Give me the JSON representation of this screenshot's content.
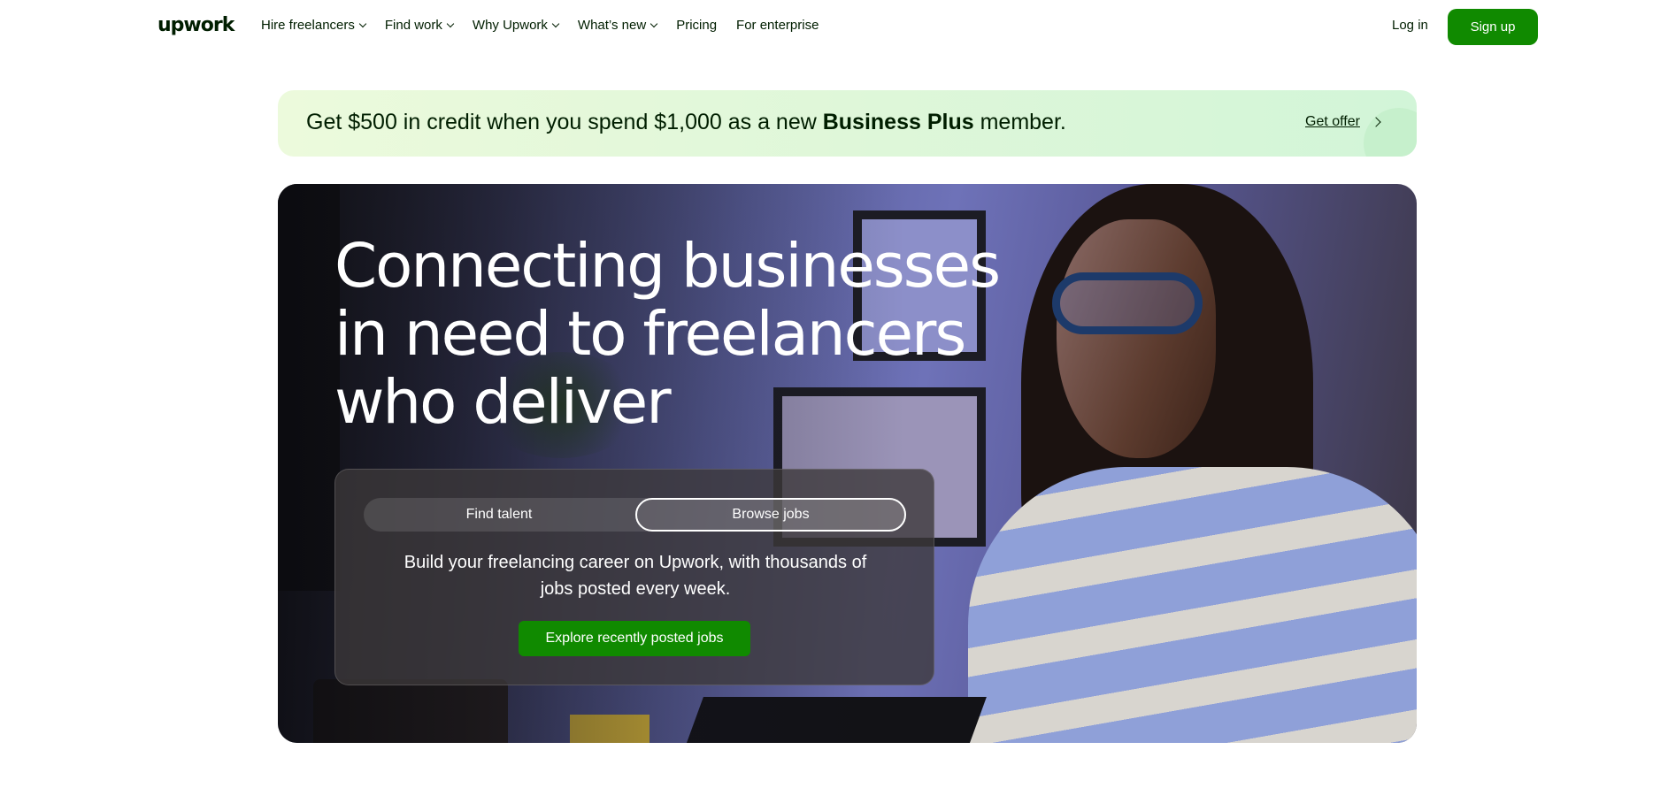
{
  "nav": {
    "logo": "upwork",
    "items": [
      {
        "label": "Hire freelancers",
        "has_dropdown": true
      },
      {
        "label": "Find work",
        "has_dropdown": true
      },
      {
        "label": "Why Upwork",
        "has_dropdown": true
      },
      {
        "label": "What’s new",
        "has_dropdown": true
      },
      {
        "label": "Pricing",
        "has_dropdown": false
      },
      {
        "label": "For enterprise",
        "has_dropdown": false
      }
    ],
    "login_label": "Log in",
    "signup_label": "Sign up"
  },
  "banner": {
    "text_before": "Get $500 in credit when you spend $1,000 as a new ",
    "text_bold": "Business Plus",
    "text_after": " member.",
    "cta_label": "Get offer"
  },
  "hero": {
    "title": "Connecting businesses in need to freelancers who deliver",
    "tabs": {
      "find_talent": "Find talent",
      "browse_jobs": "Browse jobs",
      "active": "Browse jobs"
    },
    "description": "Build your freelancing career on Upwork, with thousands of jobs posted every week.",
    "cta_label": "Explore recently posted jobs"
  },
  "colors": {
    "brand_green": "#108a00",
    "text_dark": "#001e00"
  }
}
